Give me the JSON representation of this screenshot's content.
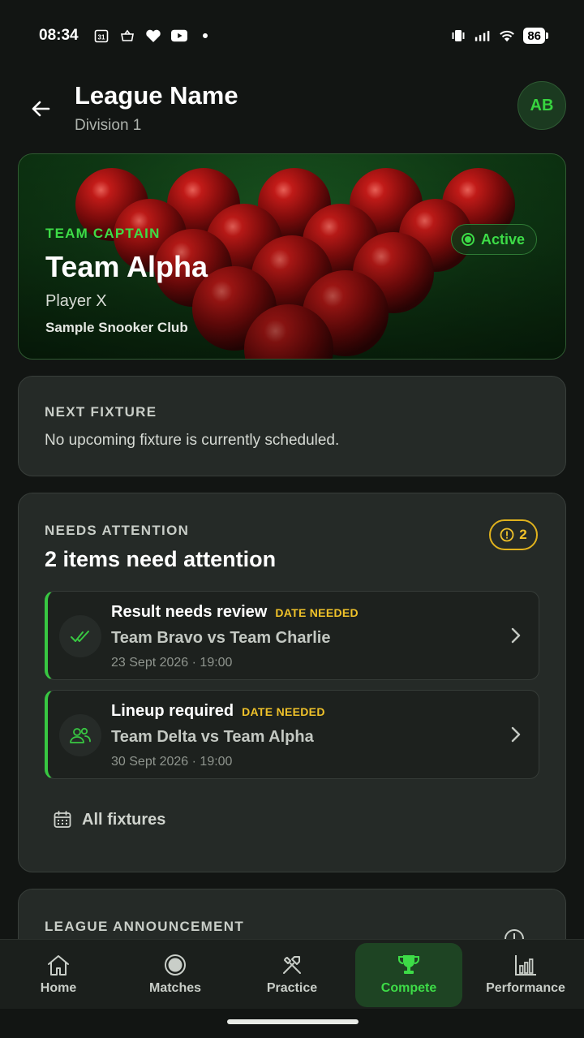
{
  "status_bar": {
    "time": "08:34",
    "battery": "86",
    "icons": [
      "calendar-icon",
      "basket-icon",
      "heart-icon",
      "youtube-icon",
      "dot-icon",
      "vibrate-icon",
      "signal-icon",
      "wifi-icon",
      "battery-icon"
    ]
  },
  "header": {
    "title": "League Name",
    "subtitle": "Division 1",
    "avatar_initials": "AB"
  },
  "hero": {
    "role": "TEAM CAPTAIN",
    "team": "Team Alpha",
    "player": "Player X",
    "club": "Sample Snooker Club",
    "status": "Active"
  },
  "next_fixture": {
    "label": "NEXT FIXTURE",
    "text": "No upcoming fixture is currently scheduled."
  },
  "attention": {
    "label": "NEEDS ATTENTION",
    "title": "2 items need attention",
    "badge_count": "2",
    "items": [
      {
        "title": "Result needs review",
        "tag": "DATE NEEDED",
        "teams": "Team Bravo vs Team Charlie",
        "date": "23 Sept 2026 · 19:00",
        "icon": "double-check-icon"
      },
      {
        "title": "Lineup required",
        "tag": "DATE NEEDED",
        "teams": "Team Delta vs Team Alpha",
        "date": "30 Sept 2026 · 19:00",
        "icon": "users-icon"
      }
    ],
    "all_fixtures_label": "All fixtures"
  },
  "announcement": {
    "label": "LEAGUE ANNOUNCEMENT"
  },
  "nav": {
    "items": [
      {
        "label": "Home",
        "icon": "home-icon"
      },
      {
        "label": "Matches",
        "icon": "ball-icon"
      },
      {
        "label": "Practice",
        "icon": "tools-icon"
      },
      {
        "label": "Compete",
        "icon": "trophy-icon"
      },
      {
        "label": "Performance",
        "icon": "bar-chart-icon"
      }
    ],
    "active": "Compete"
  },
  "colors": {
    "accent_green": "#3ddc47",
    "warning_yellow": "#f0c22a",
    "background": "#121513",
    "card": "#252a27"
  }
}
